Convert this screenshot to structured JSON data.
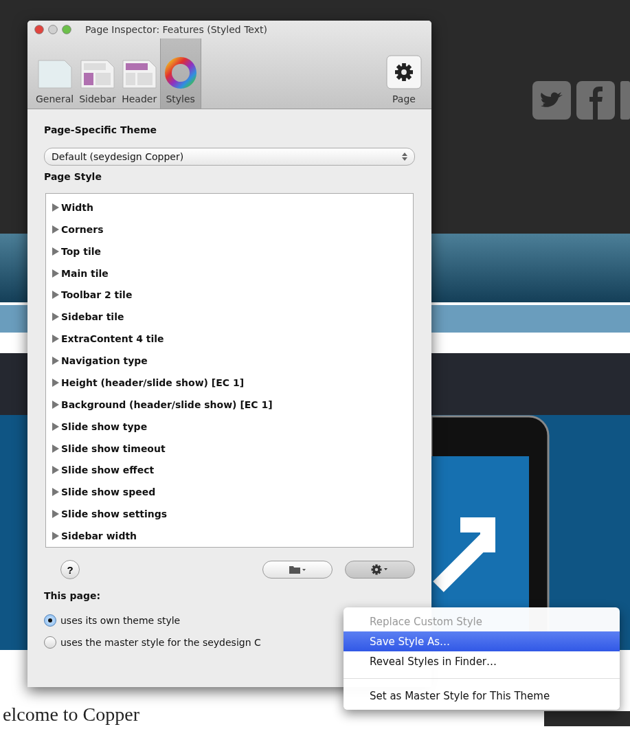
{
  "website": {
    "heading": "elcome to Copper"
  },
  "window": {
    "title": "Page Inspector: Features (Styled Text)"
  },
  "toolbar": [
    {
      "label": "General",
      "kind": "general",
      "selected": false
    },
    {
      "label": "Sidebar",
      "kind": "sidebar",
      "selected": false
    },
    {
      "label": "Header",
      "kind": "header",
      "selected": false
    },
    {
      "label": "Styles",
      "kind": "styles",
      "selected": true
    },
    {
      "label": "Page",
      "kind": "page",
      "selected": false
    }
  ],
  "theme": {
    "label": "Page-Specific Theme",
    "value": "Default (seydesign Copper)"
  },
  "page_style": {
    "label": "Page Style",
    "items": [
      {
        "label": "Width",
        "expanded": false
      },
      {
        "label": "Corners",
        "expanded": false
      },
      {
        "label": "Top tile",
        "expanded": false
      },
      {
        "label": "Main tile",
        "expanded": false
      },
      {
        "label": "Toolbar 2 tile",
        "expanded": false
      },
      {
        "label": "Sidebar tile",
        "expanded": false
      },
      {
        "label": "ExtraContent 4 tile",
        "expanded": false
      },
      {
        "label": "Navigation type",
        "expanded": false
      },
      {
        "label": "Height (header/slide show) [EC 1]",
        "expanded": false
      },
      {
        "label": "Background (header/slide show) [EC 1]",
        "expanded": false
      },
      {
        "label": "Slide show type",
        "expanded": false
      },
      {
        "label": "Slide show timeout",
        "expanded": false
      },
      {
        "label": "Slide show effect",
        "expanded": false
      },
      {
        "label": "Slide show speed",
        "expanded": false
      },
      {
        "label": "Slide show settings",
        "expanded": false
      },
      {
        "label": "Sidebar width",
        "expanded": false
      }
    ]
  },
  "help_button": {
    "label": "?"
  },
  "this_page": {
    "label": "This page:",
    "options": [
      {
        "label": "uses its own theme style",
        "selected": true
      },
      {
        "label": "uses the master style for the seydesign C",
        "selected": false
      }
    ]
  },
  "menu": {
    "items": [
      {
        "kind": "item",
        "label": "Replace Custom Style",
        "disabled": true,
        "selected": false
      },
      {
        "kind": "item",
        "label": "Save Style As…",
        "disabled": false,
        "selected": true
      },
      {
        "kind": "item",
        "label": "Reveal Styles in Finder…",
        "disabled": false,
        "selected": false
      },
      {
        "kind": "separator"
      },
      {
        "kind": "item",
        "label": "Set as Master Style for This Theme",
        "disabled": false,
        "selected": false
      }
    ]
  }
}
